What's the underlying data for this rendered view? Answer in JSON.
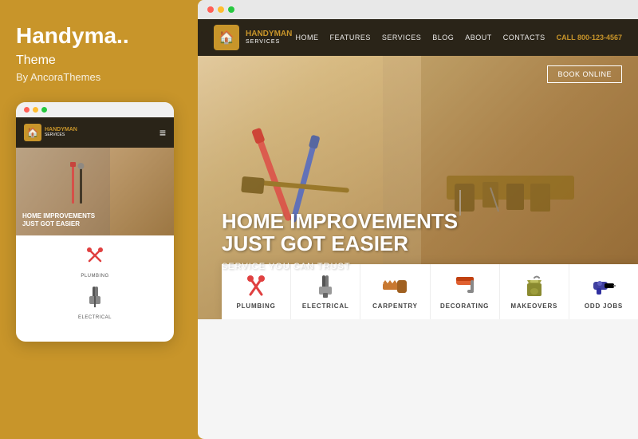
{
  "theme": {
    "title": "Handyma..",
    "subtitle": "Theme",
    "author": "By AncoraThemes"
  },
  "colors": {
    "gold": "#C8952A",
    "dark": "#2a2418",
    "white": "#ffffff",
    "dot_red": "#FF5F56",
    "dot_yellow": "#FFBD2E",
    "dot_green": "#27C93F"
  },
  "mobile": {
    "logo_top": "HANDY",
    "logo_bottom": "MAN",
    "logo_sub": "SERVICES",
    "hero_title_line1": "HOME IMPROVEMENTS",
    "hero_title_line2": "JUST GOT EASIER",
    "service1_label": "PLUMBING",
    "service2_label": "ELECTRICAL"
  },
  "desktop": {
    "logo_top": "HANDY",
    "logo_bold": "MAN",
    "logo_sub": "SERVICES",
    "nav_links": [
      "HOME",
      "FEATURES",
      "SERVICES",
      "BLOG",
      "ABOUT",
      "CONTACTS"
    ],
    "nav_call": "CALL",
    "nav_phone": "800-123-4567",
    "book_button": "BOOK ONLINE",
    "hero_title_line1": "HOME IMPROVEMENTS",
    "hero_title_line2": "JUST GOT EASIER",
    "hero_subtitle": "SERVICE YOU CAN TRUST",
    "services": [
      {
        "id": "plumbing",
        "label": "PLUMBING",
        "icon": "🔧"
      },
      {
        "id": "electrical",
        "label": "ELECTRICAL",
        "icon": "⚡"
      },
      {
        "id": "carpentry",
        "label": "CARPENTRY",
        "icon": "🪚"
      },
      {
        "id": "decorating",
        "label": "DECORATING",
        "icon": "🖌️"
      },
      {
        "id": "makeovers",
        "label": "MAKEOVERS",
        "icon": "🪣"
      },
      {
        "id": "odd-jobs",
        "label": "ODD JOBS",
        "icon": "🔨"
      }
    ]
  }
}
